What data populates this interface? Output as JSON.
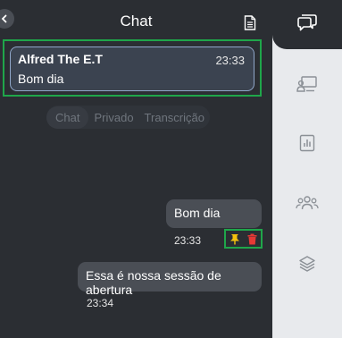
{
  "header": {
    "title": "Chat"
  },
  "pinned": {
    "author": "Alfred The E.T",
    "time": "23:33",
    "text": "Bom dia"
  },
  "tabs": [
    {
      "label": "Chat",
      "active": true
    },
    {
      "label": "Privado",
      "active": false
    },
    {
      "label": "Transcrição",
      "active": false
    }
  ],
  "messages": [
    {
      "text": "Bom dia",
      "time": "23:33"
    },
    {
      "text": "Essa é nossa sessão de abertura",
      "time": "23:34"
    }
  ],
  "icons": {
    "collapse": "chevron-left-icon",
    "document": "document-icon",
    "chat": "chat-bubbles-icon",
    "presenter": "presenter-screen-icon",
    "stats": "bar-chart-icon",
    "participants": "users-icon",
    "layers": "layers-icon",
    "pin": "pin-icon",
    "delete": "trash-icon"
  },
  "colors": {
    "highlight": "#1fa64a",
    "pin": "#f4c20d",
    "delete": "#e53935",
    "panel": "#2b2e33",
    "rail": "#e8eaed",
    "bubble": "#4a4e55"
  }
}
